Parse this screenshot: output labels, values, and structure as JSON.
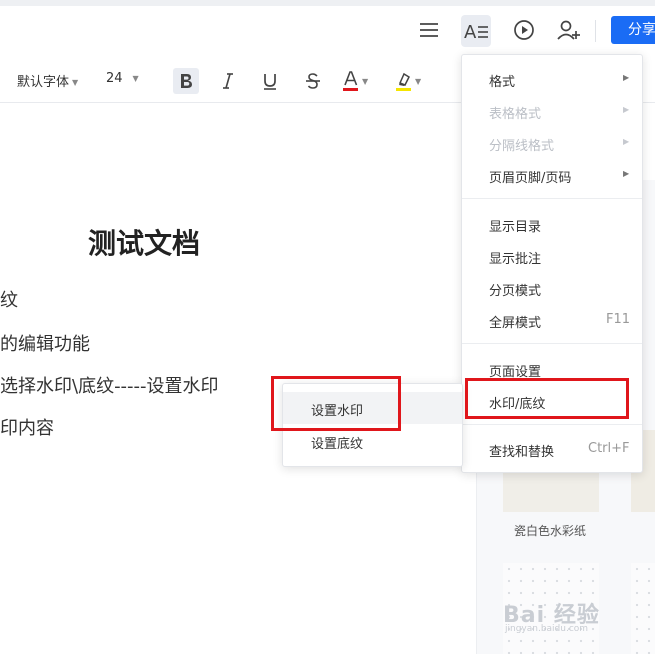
{
  "toolbar": {
    "font_family": "默认字体",
    "font_size": "24",
    "share_label": "分享"
  },
  "icons": {
    "outline": "outline-list-icon",
    "text_format": "text-format-icon",
    "play": "play-icon",
    "add_user": "add-user-icon",
    "bold": "bold-icon",
    "italic": "italic-icon",
    "underline": "underline-icon",
    "strikethrough": "strikethrough-icon",
    "font_color": "font-color-icon",
    "highlight": "highlight-icon"
  },
  "colors": {
    "accent": "#1a6cf5",
    "font_color_bar": "#e0161b",
    "highlight_bar": "#f5e500",
    "annotation_red": "#e0161b"
  },
  "document": {
    "title": "测试文档",
    "lines": [
      "纹",
      "的编辑功能",
      "选择水印\\底纹-----设置水印",
      "印内容"
    ]
  },
  "menu": {
    "items": [
      {
        "label": "格式",
        "disabled": false,
        "has_submenu": true
      },
      {
        "label": "表格格式",
        "disabled": true,
        "has_submenu": true
      },
      {
        "label": "分隔线格式",
        "disabled": true,
        "has_submenu": true
      },
      {
        "label": "页眉页脚/页码",
        "disabled": false,
        "has_submenu": true
      },
      {
        "label": "显示目录",
        "disabled": false
      },
      {
        "label": "显示批注",
        "disabled": false
      },
      {
        "label": "分页模式",
        "disabled": false
      },
      {
        "label": "全屏模式",
        "disabled": false,
        "shortcut": "F11"
      },
      {
        "label": "页面设置",
        "disabled": false
      },
      {
        "label": "水印/底纹",
        "disabled": false
      },
      {
        "label": "查找和替换",
        "disabled": false,
        "shortcut": "Ctrl+F"
      }
    ]
  },
  "submenu": {
    "items": [
      {
        "label": "设置水印"
      },
      {
        "label": "设置底纹"
      }
    ]
  },
  "panel": {
    "thumb_label": "瓷白色水彩纸",
    "watermark_text": "Bai 经验",
    "watermark_sub": "jingyan.baidu.com"
  }
}
